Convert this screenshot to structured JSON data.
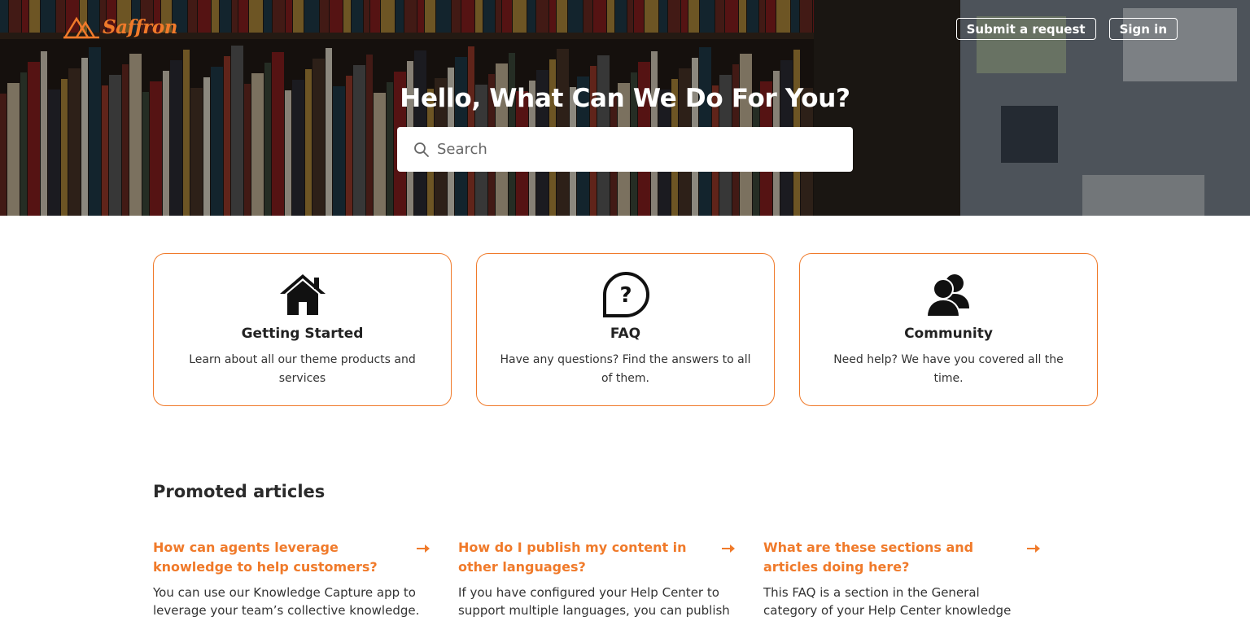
{
  "brand": {
    "name": "Saffron",
    "accent": "#f07a2a"
  },
  "header": {
    "submit_label": "Submit a request",
    "signin_label": "Sign in"
  },
  "hero": {
    "title": "Hello, What Can We Do For You?",
    "search_placeholder": "Search"
  },
  "cards": [
    {
      "icon": "house-icon",
      "title": "Getting Started",
      "description": "Learn about all our theme products and services"
    },
    {
      "icon": "question-bubble-icon",
      "title": "FAQ",
      "description": "Have any questions? Find the answers to all of them."
    },
    {
      "icon": "users-icon",
      "title": "Community",
      "description": "Need help? We have you covered all the time."
    }
  ],
  "promoted": {
    "heading": "Promoted articles",
    "articles": [
      {
        "title": "How can agents leverage knowledge to help customers?",
        "excerpt": "You can use our Knowledge Capture app to leverage your team’s collective knowledge."
      },
      {
        "title": "How do I publish my content in other languages?",
        "excerpt": "If you have configured your Help Center to support multiple languages, you can publish"
      },
      {
        "title": "What are these sections and articles doing here?",
        "excerpt": "This FAQ is a section in the General category of your Help Center knowledge base. We created"
      }
    ]
  }
}
